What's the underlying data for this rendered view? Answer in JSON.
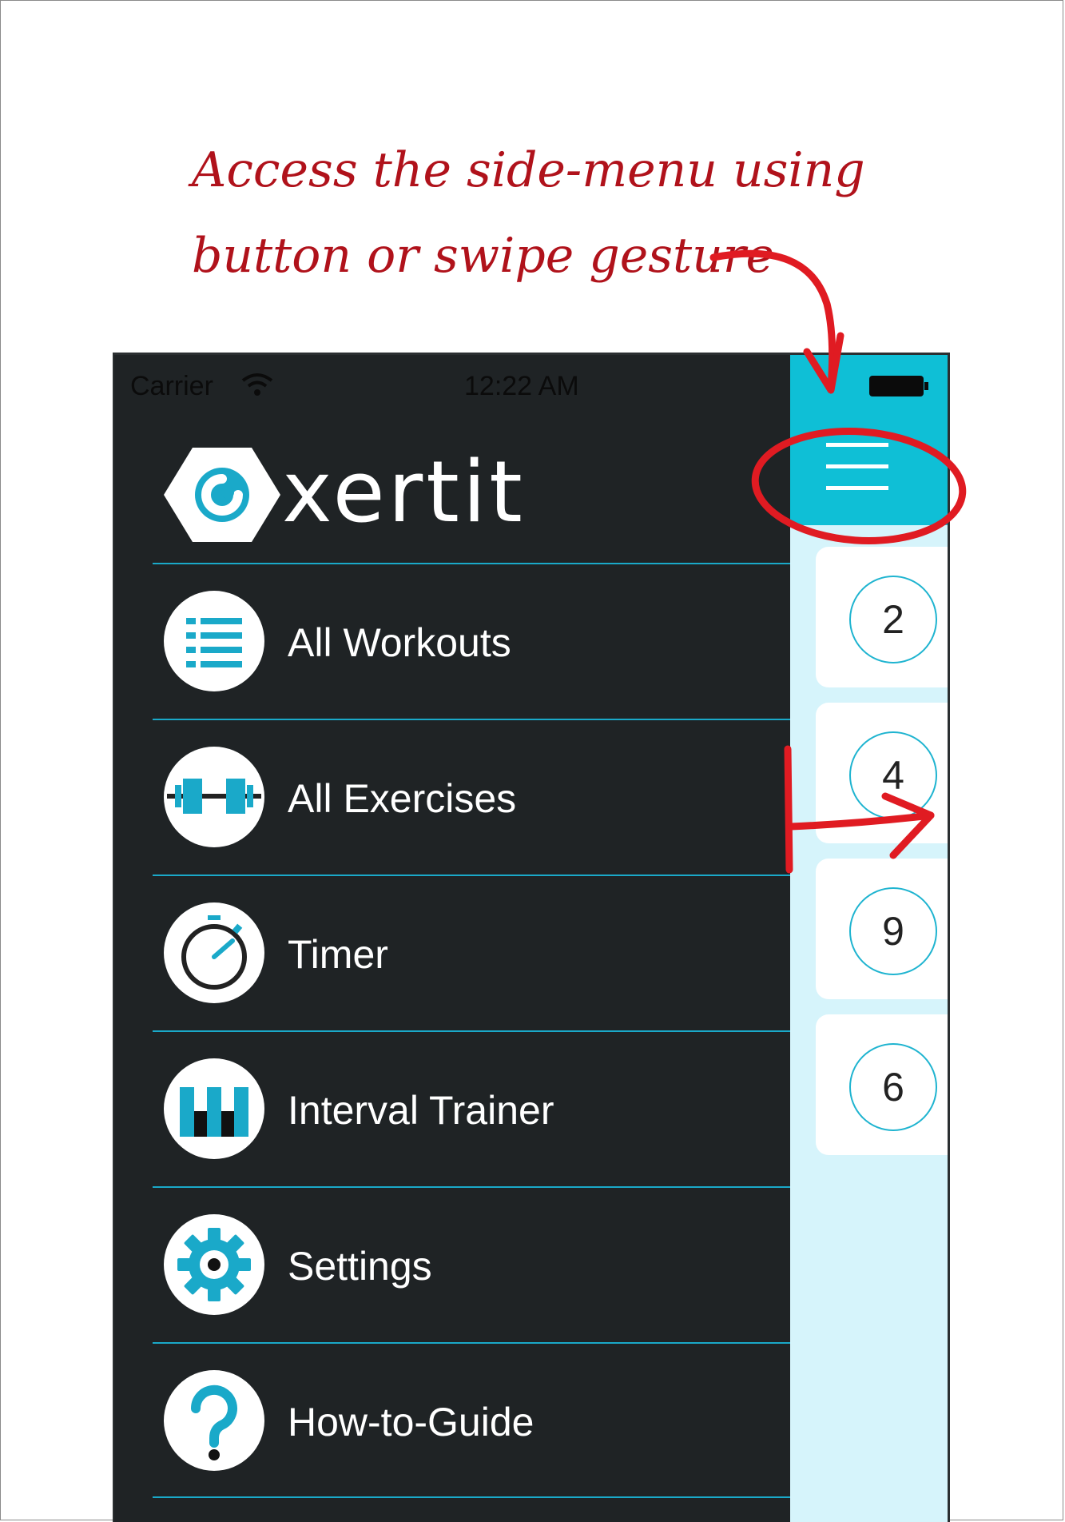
{
  "annotation": {
    "line1": "Access the side-menu using",
    "line2": "button or swipe gesture"
  },
  "status_bar": {
    "carrier": "Carrier",
    "time": "12:22 AM"
  },
  "brand": {
    "name": "xertit",
    "accent_color": "#1aa9c9"
  },
  "menu": {
    "items": [
      {
        "label": "All Workouts",
        "icon": "list-icon"
      },
      {
        "label": "All Exercises",
        "icon": "dumbbell-icon"
      },
      {
        "label": "Timer",
        "icon": "stopwatch-icon"
      },
      {
        "label": "Interval Trainer",
        "icon": "interval-bars-icon"
      },
      {
        "label": "Settings",
        "icon": "gear-icon"
      },
      {
        "label": "How-to-Guide",
        "icon": "question-icon"
      }
    ]
  },
  "main": {
    "header_color": "#0fbfd6",
    "cards": [
      "2",
      "4",
      "9",
      "6"
    ]
  },
  "overlay": {
    "color": "#e01b22"
  }
}
